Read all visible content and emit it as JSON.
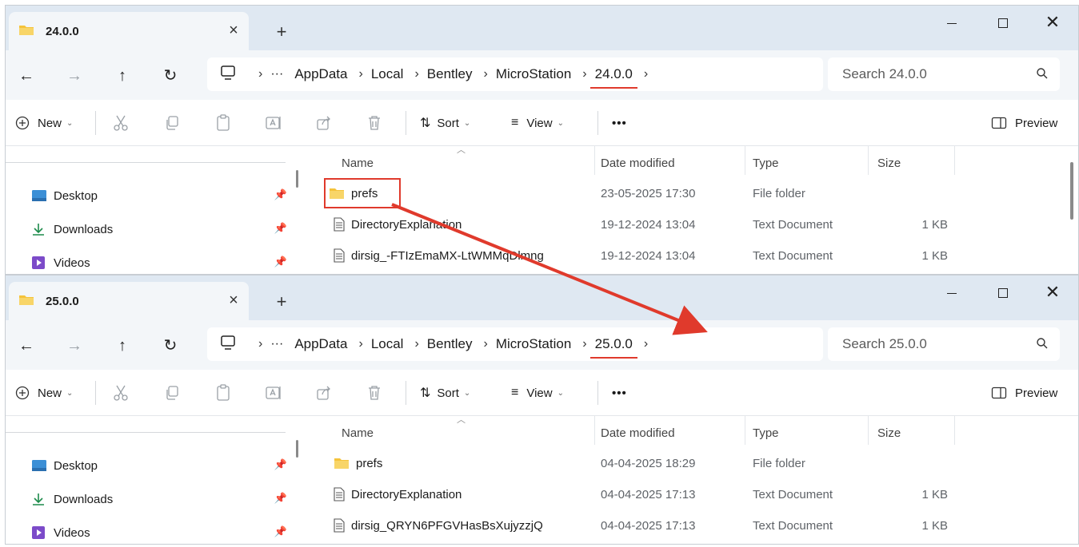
{
  "colors": {
    "accent_red": "#e03a2c",
    "titlebar_bg": "#dfe8f2",
    "folder_yellow": "#f5c33b"
  },
  "windows": [
    {
      "tab_title": "24.0.0",
      "breadcrumb": [
        "AppData",
        "Local",
        "Bentley",
        "MicroStation",
        "24.0.0"
      ],
      "search_placeholder": "Search 24.0.0",
      "toolbar": {
        "new_label": "New",
        "sort_label": "Sort",
        "view_label": "View",
        "more_label": "•••",
        "preview_label": "Preview"
      },
      "nav_items": [
        "Desktop",
        "Downloads",
        "Videos"
      ],
      "columns": {
        "name": "Name",
        "date": "Date modified",
        "type": "Type",
        "size": "Size"
      },
      "files": [
        {
          "name": "prefs",
          "icon": "folder-icon",
          "date": "23-05-2025 17:30",
          "type": "File folder",
          "size": ""
        },
        {
          "name": "DirectoryExplanation",
          "icon": "text-document-icon",
          "date": "19-12-2024 13:04",
          "type": "Text Document",
          "size": "1 KB"
        },
        {
          "name": "dirsig_-FTIzEmaMX-LtWMMqDlmng",
          "icon": "text-document-icon",
          "date": "19-12-2024 13:04",
          "type": "Text Document",
          "size": "1 KB"
        }
      ]
    },
    {
      "tab_title": "25.0.0",
      "breadcrumb": [
        "AppData",
        "Local",
        "Bentley",
        "MicroStation",
        "25.0.0"
      ],
      "search_placeholder": "Search 25.0.0",
      "toolbar": {
        "new_label": "New",
        "sort_label": "Sort",
        "view_label": "View",
        "more_label": "•••",
        "preview_label": "Preview"
      },
      "nav_items": [
        "Desktop",
        "Downloads",
        "Videos"
      ],
      "columns": {
        "name": "Name",
        "date": "Date modified",
        "type": "Type",
        "size": "Size"
      },
      "files": [
        {
          "name": "prefs",
          "icon": "folder-icon",
          "date": "04-04-2025 18:29",
          "type": "File folder",
          "size": ""
        },
        {
          "name": "DirectoryExplanation",
          "icon": "text-document-icon",
          "date": "04-04-2025 17:13",
          "type": "Text Document",
          "size": "1 KB"
        },
        {
          "name": "dirsig_QRYN6PFGVHasBsXujyzzjQ",
          "icon": "text-document-icon",
          "date": "04-04-2025 17:13",
          "type": "Text Document",
          "size": "1 KB"
        }
      ]
    }
  ]
}
